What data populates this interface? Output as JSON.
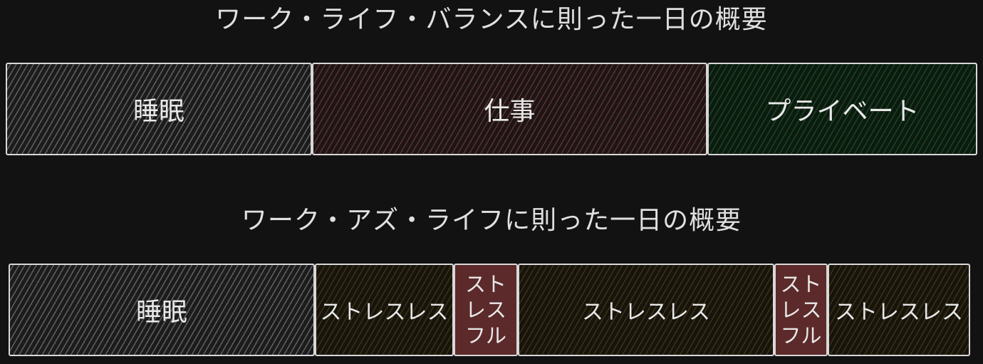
{
  "diagram1": {
    "title": "ワーク・ライフ・バランスに則った一日の概要",
    "segments": [
      {
        "label": "睡眠",
        "color": "#9a9a9a"
      },
      {
        "label": "仕事",
        "color": "#8a4a4a"
      },
      {
        "label": "プライベート",
        "color": "#1f6a2f"
      }
    ]
  },
  "diagram2": {
    "title": "ワーク・アズ・ライフに則った一日の概要",
    "segments": [
      {
        "label": "睡眠",
        "color": "#9a9a9a"
      },
      {
        "label": "ストレスレス",
        "color": "#5a4a1e"
      },
      {
        "label": "ストレスフル",
        "color": "#5c2a2a"
      },
      {
        "label": "ストレスレス",
        "color": "#5a4a1e"
      },
      {
        "label": "ストレスフル",
        "color": "#5c2a2a"
      },
      {
        "label": "ストレスレス",
        "color": "#5a4a1e"
      }
    ]
  }
}
